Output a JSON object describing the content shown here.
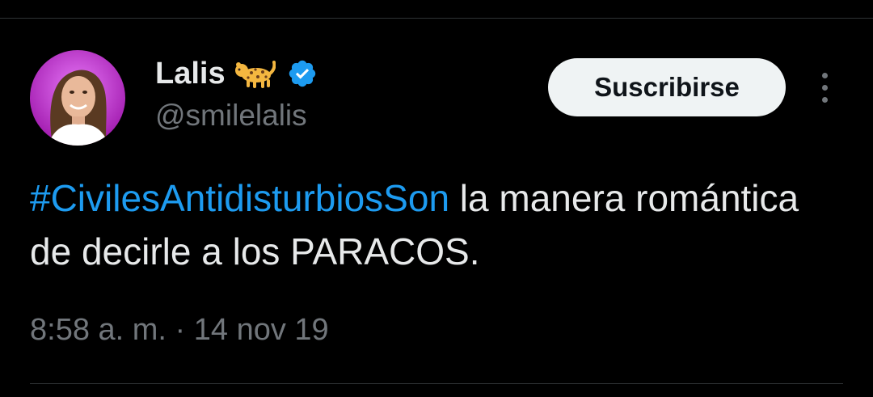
{
  "author": {
    "display_name": "Lalis",
    "username": "@smilelalis",
    "name_emoji_icon": "leopard-emoji-icon",
    "verified_icon": "verified-badge-icon",
    "verified_color": "#1d9bf0"
  },
  "header": {
    "subscribe_label": "Suscribirse",
    "more_icon": "more-vertical-icon"
  },
  "tweet": {
    "hashtag": "#CivilesAntidisturbiosSon",
    "text_after_hashtag": " la manera romántica de decirle a los PARACOS."
  },
  "meta": {
    "time": "8:58 a. m.",
    "separator": " · ",
    "date": "14 nov 19"
  },
  "colors": {
    "background": "#000000",
    "text": "#e7e9ea",
    "secondary_text": "#71767b",
    "link": "#1d9bf0",
    "divider": "#2f3336",
    "button_bg": "#eff3f4"
  }
}
